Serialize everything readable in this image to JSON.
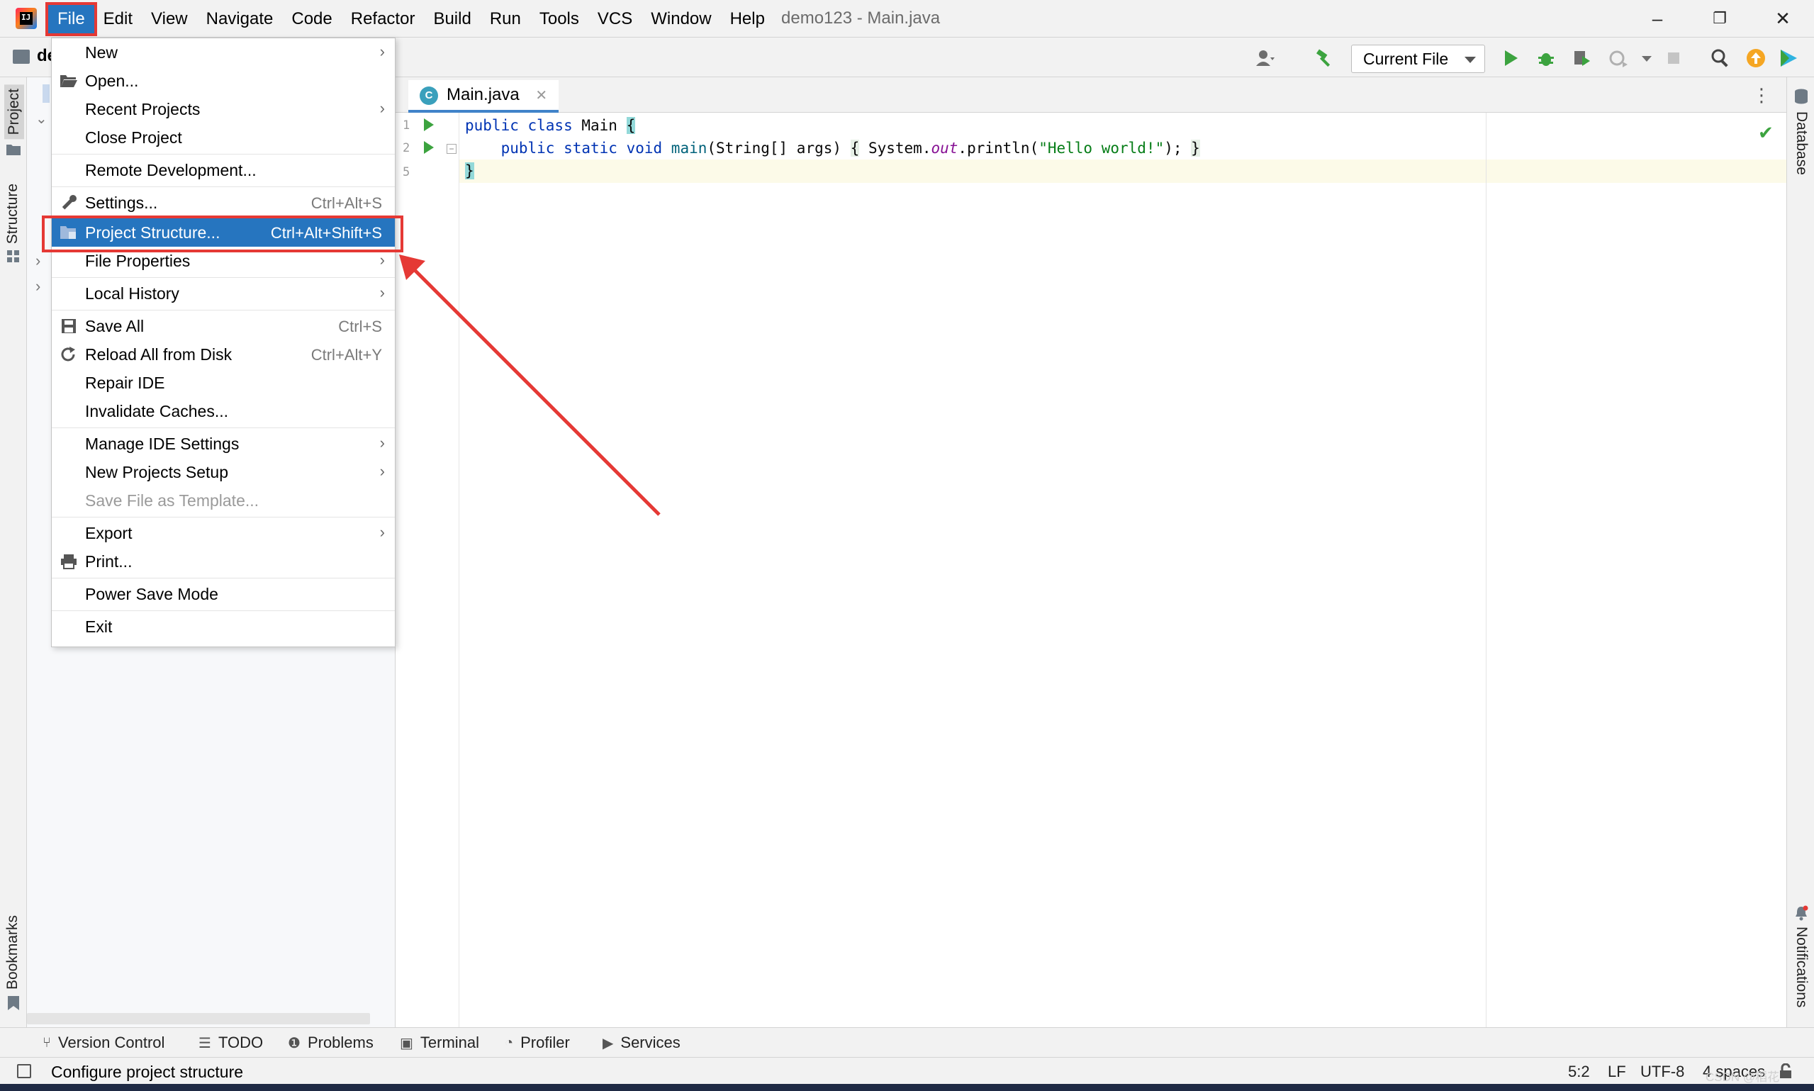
{
  "app": {
    "window_title": "demo123 - Main.java",
    "logo_text": "IJ"
  },
  "menubar": [
    {
      "label": "File",
      "active": true
    },
    {
      "label": "Edit"
    },
    {
      "label": "View"
    },
    {
      "label": "Navigate"
    },
    {
      "label": "Code"
    },
    {
      "label": "Refactor"
    },
    {
      "label": "Build"
    },
    {
      "label": "Run"
    },
    {
      "label": "Tools"
    },
    {
      "label": "VCS"
    },
    {
      "label": "Window"
    },
    {
      "label": "Help"
    }
  ],
  "window_buttons": {
    "minimize": "–",
    "restore": "❐",
    "close": "✕"
  },
  "toolbar": {
    "project_crumb": "de",
    "run_config": "Current File"
  },
  "left_tabs": {
    "project": "Project",
    "structure": "Structure",
    "bookmarks": "Bookmarks"
  },
  "right_tabs": {
    "database": "Database",
    "notifications": "Notifications"
  },
  "file_menu": {
    "items": [
      {
        "label": "New",
        "submenu": true
      },
      {
        "label": "Open...",
        "icon": "folder-open-icon"
      },
      {
        "label": "Recent Projects",
        "submenu": true
      },
      {
        "label": "Close Project"
      },
      {
        "label": "Remote Development..."
      },
      {
        "label": "Settings...",
        "shortcut": "Ctrl+Alt+S",
        "icon": "wrench-icon"
      },
      {
        "label": "Project Structure...",
        "shortcut": "Ctrl+Alt+Shift+S",
        "icon": "project-structure-icon",
        "selected": true
      },
      {
        "label": "File Properties",
        "submenu": true
      },
      {
        "label": "Local History",
        "submenu": true
      },
      {
        "label": "Save All",
        "shortcut": "Ctrl+S",
        "icon": "save-icon"
      },
      {
        "label": "Reload All from Disk",
        "shortcut": "Ctrl+Alt+Y",
        "icon": "reload-icon"
      },
      {
        "label": "Repair IDE"
      },
      {
        "label": "Invalidate Caches..."
      },
      {
        "label": "Manage IDE Settings",
        "submenu": true
      },
      {
        "label": "New Projects Setup",
        "submenu": true
      },
      {
        "label": "Save File as Template...",
        "disabled": true
      },
      {
        "label": "Export",
        "submenu": true
      },
      {
        "label": "Print...",
        "icon": "print-icon"
      },
      {
        "label": "Power Save Mode"
      },
      {
        "label": "Exit"
      }
    ]
  },
  "editor": {
    "tab_label": "Main.java",
    "tab_icon_letter": "C",
    "line_numbers": [
      "1",
      "2",
      "5"
    ],
    "code": {
      "l1_kw": "public class",
      "l1_name": " Main ",
      "l1_brace": "{",
      "l2_indent": "    ",
      "l2_kw": "public static void",
      "l2_fn": " main",
      "l2_params": "(String[] args) ",
      "l2_fold_open": "{",
      "l2_sys": " System.",
      "l2_out": "out",
      "l2_print": ".println(",
      "l2_str": "\"Hello world!\"",
      "l2_end": "); ",
      "l2_fold_close": "}",
      "l3_brace": "}"
    }
  },
  "bottom_tools": [
    {
      "label": "Version Control",
      "icon": "branch-icon"
    },
    {
      "label": "TODO",
      "icon": "list-icon"
    },
    {
      "label": "Problems",
      "icon": "warning-icon"
    },
    {
      "label": "Terminal",
      "icon": "terminal-icon"
    },
    {
      "label": "Profiler",
      "icon": "profiler-icon"
    },
    {
      "label": "Services",
      "icon": "services-icon"
    }
  ],
  "status": {
    "message": "Configure project structure",
    "position": "5:2",
    "line_sep": "LF",
    "encoding": "UTF-8",
    "indent": "4 spaces",
    "watermark": "CSDN @稻花"
  },
  "colors": {
    "accent": "#2675bf",
    "highlight": "#e53935",
    "run_green": "#3ca33f"
  }
}
